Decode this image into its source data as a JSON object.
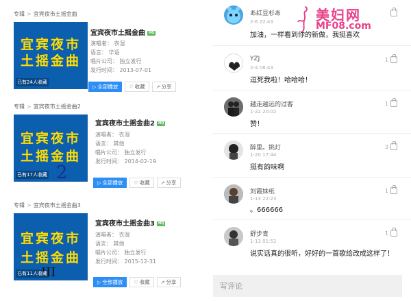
{
  "albums": [
    {
      "crumb_root": "专辑",
      "crumb_sep": ">",
      "crumb_name": "宜宾夜市土摇金曲",
      "title": "宜宾夜市土摇金曲",
      "quality": "HQ",
      "cover_line1": "宜宾夜市",
      "cover_line2": "土摇金曲",
      "cover_fav": "已有24人收藏",
      "singer": "演唱者：  衣湿",
      "language": "语言：  华语",
      "company": "唱片公司：  独立发行",
      "date": "发行时间：  2013-07-01",
      "play": "全部播放",
      "fav": "收藏",
      "share": "分享",
      "handwriting": ""
    },
    {
      "crumb_root": "专辑",
      "crumb_sep": ">",
      "crumb_name": "宜宾夜市土摇金曲2",
      "title": "宜宾夜市土摇金曲2",
      "quality": "HQ",
      "cover_line1": "宜宾夜市",
      "cover_line2": "土摇金曲",
      "cover_fav": "已有17人收藏",
      "singer": "演唱者：  衣湿",
      "language": "语言：  其他",
      "company": "唱片公司：  独立发行",
      "date": "发行时间：  2014-02-19",
      "play": "全部播放",
      "fav": "收藏",
      "share": "分享",
      "handwriting": "2"
    },
    {
      "crumb_root": "专辑",
      "crumb_sep": ">",
      "crumb_name": "宜宾夜市土摇金曲3",
      "title": "宜宾夜市土摇金曲3",
      "quality": "HQ",
      "cover_line1": "宜宾夜市",
      "cover_line2": "土摇金曲",
      "cover_fav": "已有11人收藏",
      "singer": "演唱者：  衣湿",
      "language": "语言：  其他",
      "company": "唱片公司：  独立发行",
      "date": "发行时间：  2015-12-31",
      "play": "全部播放",
      "fav": "收藏",
      "share": "分享",
      "handwriting": "III"
    }
  ],
  "watermark": {
    "brand": "美妇网",
    "url": "MF08.com"
  },
  "comments": [
    {
      "user": "あ红豆杉あ",
      "time": "2-6 22:43",
      "likes": "",
      "text": "加油，一样看到你的新做，我挺喜欢"
    },
    {
      "user": "YZJ",
      "time": "2-4 08:43",
      "likes": "1",
      "text": "逗死我啦！哈哈哈！"
    },
    {
      "user": "越走越远的过客",
      "time": "1-22 20:02",
      "likes": "1",
      "text": "赞！"
    },
    {
      "user": "醉里。挑灯",
      "time": "1-20 17:44",
      "likes": "3",
      "text": "挺有韵味啊"
    },
    {
      "user": "刘霞妹纸",
      "time": "1-13 22:23",
      "likes": "1",
      "text": "。666666"
    },
    {
      "user": "舒步青",
      "time": "1-13 01:52",
      "likes": "1",
      "text": "说实话真的很听，好好的一首歌给改成这样了！"
    }
  ],
  "input": {
    "placeholder": "写评论"
  },
  "colors": {
    "cover_bg": "#0c5fae",
    "cover_text": "#ffdd00",
    "accent": "#2d8ef5",
    "brand_pink": "#e8418a"
  }
}
